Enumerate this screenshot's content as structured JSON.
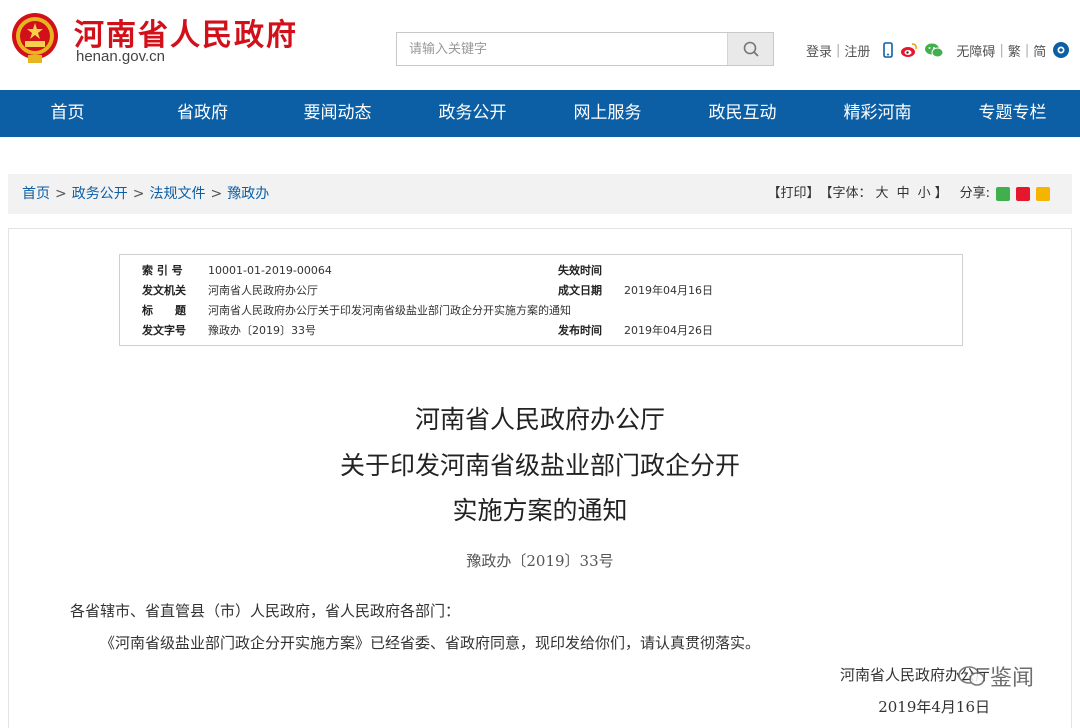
{
  "header": {
    "site_title": "河南省人民政府",
    "site_domain": "henan.gov.cn",
    "search_placeholder": "请输入关键字",
    "login": "登录",
    "register": "注册",
    "accessibility": "无障碍",
    "traditional": "繁",
    "simplified": "简"
  },
  "nav": {
    "items": [
      "首页",
      "省政府",
      "要闻动态",
      "政务公开",
      "网上服务",
      "政民互动",
      "精彩河南",
      "专题专栏"
    ]
  },
  "breadcrumb": {
    "items": [
      "首页",
      "政务公开",
      "法规文件",
      "豫政办"
    ],
    "separator": ">"
  },
  "tools": {
    "print": "【打印】",
    "font_label": "【字体：",
    "font_large": "大",
    "font_medium": "中",
    "font_small": "小",
    "font_end": "】",
    "share_label": "分享:"
  },
  "meta": {
    "index_label": "索 引 号",
    "index_value": "10001-01-2019-00064",
    "expire_label": "失效时间",
    "expire_value": "",
    "issuer_label": "发文机关",
    "issuer_value": "河南省人民政府办公厅",
    "created_label": "成文日期",
    "created_value": "2019年04月16日",
    "title_label": "标　　题",
    "title_value": "河南省人民政府办公厅关于印发河南省级盐业部门政企分开实施方案的通知",
    "docno_label": "发文字号",
    "docno_value": "豫政办〔2019〕33号",
    "published_label": "发布时间",
    "published_value": "2019年04月26日"
  },
  "document": {
    "title_line1": "河南省人民政府办公厅",
    "title_line2": "关于印发河南省级盐业部门政企分开",
    "title_line3": "实施方案的通知",
    "number": "豫政办〔2019〕33号",
    "addressee": "各省辖市、省直管县（市）人民政府，省人民政府各部门：",
    "body": "《河南省级盐业部门政企分开实施方案》已经省委、省政府同意，现印发给你们，请认真贯彻落实。",
    "signer": "河南省人民政府办公厅",
    "date": "2019年4月16日"
  },
  "watermark": {
    "text": "鉴闻"
  },
  "colors": {
    "brand_red": "#d1101a",
    "nav_blue": "#0d5fa5",
    "breadcrumb_bg": "#f2f2f2"
  }
}
